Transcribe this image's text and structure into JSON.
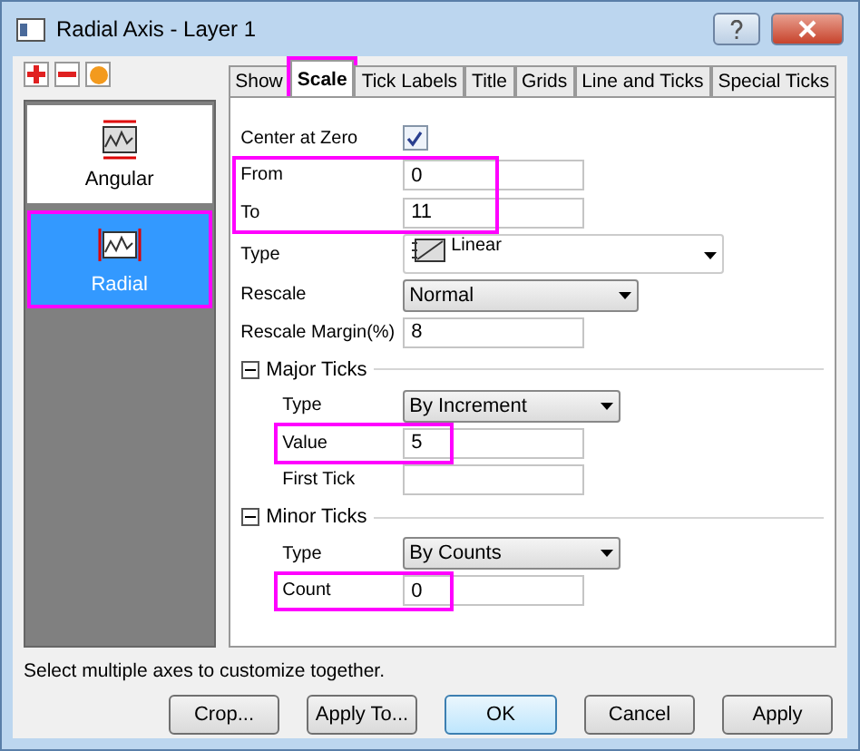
{
  "window": {
    "title": "Radial Axis - Layer 1"
  },
  "axes": [
    {
      "label": "Angular",
      "selected": false,
      "highlighted": false
    },
    {
      "label": "Radial",
      "selected": true,
      "highlighted": true
    }
  ],
  "tabs": [
    {
      "label": "Show",
      "selected": false,
      "highlighted": false
    },
    {
      "label": "Scale",
      "selected": true,
      "highlighted": true
    },
    {
      "label": "Tick Labels",
      "selected": false,
      "highlighted": false
    },
    {
      "label": "Title",
      "selected": false,
      "highlighted": false
    },
    {
      "label": "Grids",
      "selected": false,
      "highlighted": false
    },
    {
      "label": "Line and Ticks",
      "selected": false,
      "highlighted": false
    },
    {
      "label": "Special Ticks",
      "selected": false,
      "highlighted": false
    }
  ],
  "rows": [
    {
      "kind": "checkbox",
      "label": "Center at Zero",
      "checked": true
    },
    {
      "kind": "highlight",
      "children": [
        {
          "kind": "text",
          "label": "From",
          "value": "0"
        },
        {
          "kind": "text",
          "label": "To",
          "value": "11"
        }
      ]
    },
    {
      "kind": "type",
      "label": "Type",
      "value": "Linear"
    },
    {
      "kind": "select",
      "label": "Rescale",
      "value": "Normal"
    },
    {
      "kind": "text",
      "label": "Rescale Margin(%)",
      "value": "8"
    },
    {
      "kind": "section",
      "label": "Major Ticks",
      "expanded": true,
      "children": [
        {
          "kind": "select",
          "label": "Type",
          "value": "By Increment"
        },
        {
          "kind": "highlight",
          "children": [
            {
              "kind": "text",
              "label": "Value",
              "value": "5"
            }
          ]
        },
        {
          "kind": "text",
          "label": "First Tick"
        }
      ]
    },
    {
      "kind": "section",
      "label": "Minor Ticks",
      "expanded": true,
      "children": [
        {
          "kind": "select",
          "label": "Type",
          "value": "By Counts"
        },
        {
          "kind": "highlight",
          "children": [
            {
              "kind": "text",
              "label": "Count",
              "value": "0"
            }
          ]
        }
      ]
    }
  ],
  "status": "Select multiple axes to customize together.",
  "buttons": [
    {
      "label": "Crop...",
      "default": false
    },
    {
      "label": "Apply To...",
      "default": false
    },
    {
      "label": "OK",
      "default": true
    },
    {
      "label": "Cancel",
      "default": false
    },
    {
      "label": "Apply",
      "default": false
    }
  ]
}
